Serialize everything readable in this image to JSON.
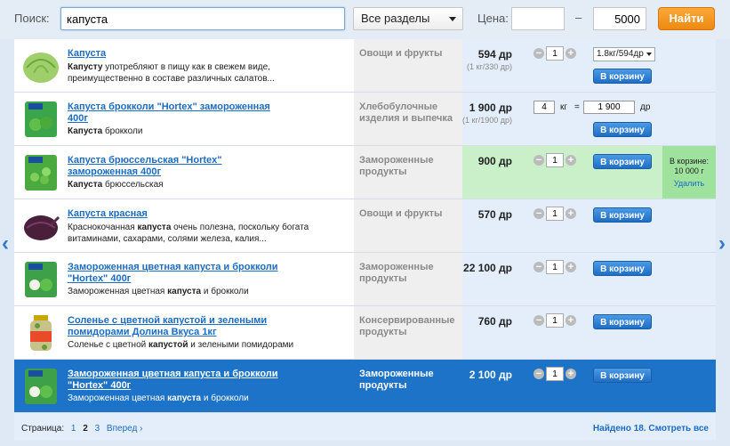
{
  "search": {
    "label": "Поиск:",
    "value": "капуста",
    "section": "Все разделы",
    "price_label": "Цена:",
    "price_from": "",
    "price_dash": "–",
    "price_to": "5000",
    "find_label": "Найти"
  },
  "nav": {
    "prev": "‹",
    "next": "›"
  },
  "results": [
    {
      "title": "Капуста",
      "desc_bold": "Капусту",
      "desc": " употребляют в пищу как в свежем виде, преимущественно в составе различных салатов...",
      "category": "Овощи и фрукты",
      "price": "594 др",
      "sub": "(1 кг/330 др)",
      "qty": "1",
      "weight_option": "1.8кг/594др",
      "cart_label": "В корзину",
      "thumb_icon": "cabbage-icon"
    },
    {
      "title": "Капуста брокколи \"Hortex\" замороженная 400г",
      "desc_bold": "Капуста",
      "desc": " брокколи",
      "category": "Хлебобулочные изделия и выпечка",
      "price": "1 900 др",
      "sub": "(1 кг/1900 др)",
      "qty": "4",
      "unit": "кг",
      "equals": "=",
      "amount": "1 900",
      "currency": "др",
      "cart_label": "В корзину",
      "thumb_icon": "frozen-broccoli-icon"
    },
    {
      "title": "Капуста брюссельская \"Hortex\" замороженная 400г",
      "desc_bold": "Капуста",
      "desc": " брюссельская",
      "category": "Замороженные продукты",
      "price": "900 др",
      "qty": "1",
      "cart_label": "В корзину",
      "in_cart_label": "В корзине:",
      "in_cart_value": "10 000 г",
      "remove_label": "Удалить",
      "thumb_icon": "frozen-sprouts-icon"
    },
    {
      "title": "Капуста красная",
      "desc_pre": "Краснокочанная ",
      "desc_bold": "капуста",
      "desc": " очень полезна, поскольку богата витаминами, сахарами, солями железа, калия...",
      "category": "Овощи и фрукты",
      "price": "570 др",
      "qty": "1",
      "cart_label": "В корзину",
      "thumb_icon": "red-cabbage-icon"
    },
    {
      "title": "Замороженная цветная капуста и брокколи \"Hortex\" 400г",
      "desc_pre": "Замороженная цветная ",
      "desc_bold": "капуста",
      "desc": " и брокколи",
      "category": "Замороженные продукты",
      "price": "22 100 др",
      "qty": "1",
      "cart_label": "В корзину",
      "thumb_icon": "frozen-mix-icon"
    },
    {
      "title": "Соленье с цветной капустой и зелеными помидорами Долина Вкуса 1кг",
      "desc_pre": "Соленье с цветной ",
      "desc_bold": "капустой",
      "desc": " и зелеными помидорами",
      "category": "Консервированные продукты",
      "price": "760 др",
      "qty": "1",
      "cart_label": "В корзину",
      "thumb_icon": "jar-icon"
    },
    {
      "title": "Замороженная цветная капуста и брокколи \"Hortex\" 400г",
      "desc_pre": "Замороженная цветная ",
      "desc_bold": "капуста",
      "desc": " и брокколи",
      "category": "Замороженные продукты",
      "price": "2 100 др",
      "qty": "1",
      "cart_label": "В корзину",
      "thumb_icon": "frozen-mix-icon"
    }
  ],
  "footer": {
    "page_label": "Страница:",
    "pages": [
      "1",
      "2",
      "3"
    ],
    "next_label": "Вперед ›",
    "found": "Найдено 18. Смотреть все"
  },
  "colors": {
    "accent": "#1c73c8",
    "button_orange": "#ee8a11",
    "green_row": "#c9f0c9"
  }
}
